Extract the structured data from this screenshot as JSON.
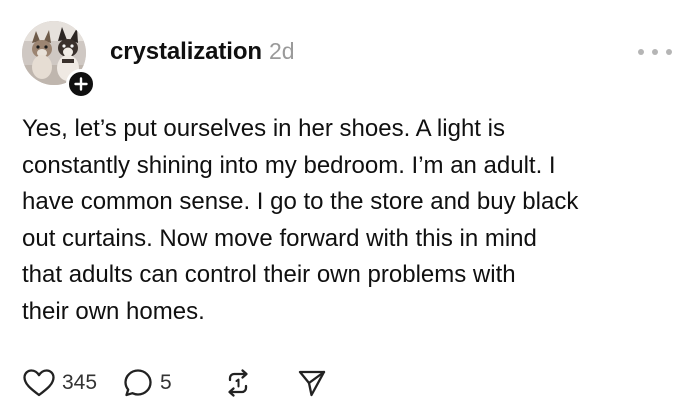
{
  "post": {
    "username": "crystalization",
    "timestamp": "2d",
    "text": "Yes, let’s put ourselves in her shoes. A light is\nconstantly shining into my bedroom. I’m an adult. I\nhave common sense. I go to the store and buy black\nout curtains. Now move forward with this in mind\nthat adults can control their own problems with\ntheir own homes.",
    "follow_symbol": "+",
    "actions": {
      "likes": "345",
      "replies": "5"
    },
    "icons": {
      "avatar": "avatar-dogs-photo",
      "follow": "plus-icon",
      "more": "more-dots-icon",
      "like": "heart-icon",
      "reply": "comment-icon",
      "repost": "repost-icon",
      "share": "send-icon"
    }
  }
}
